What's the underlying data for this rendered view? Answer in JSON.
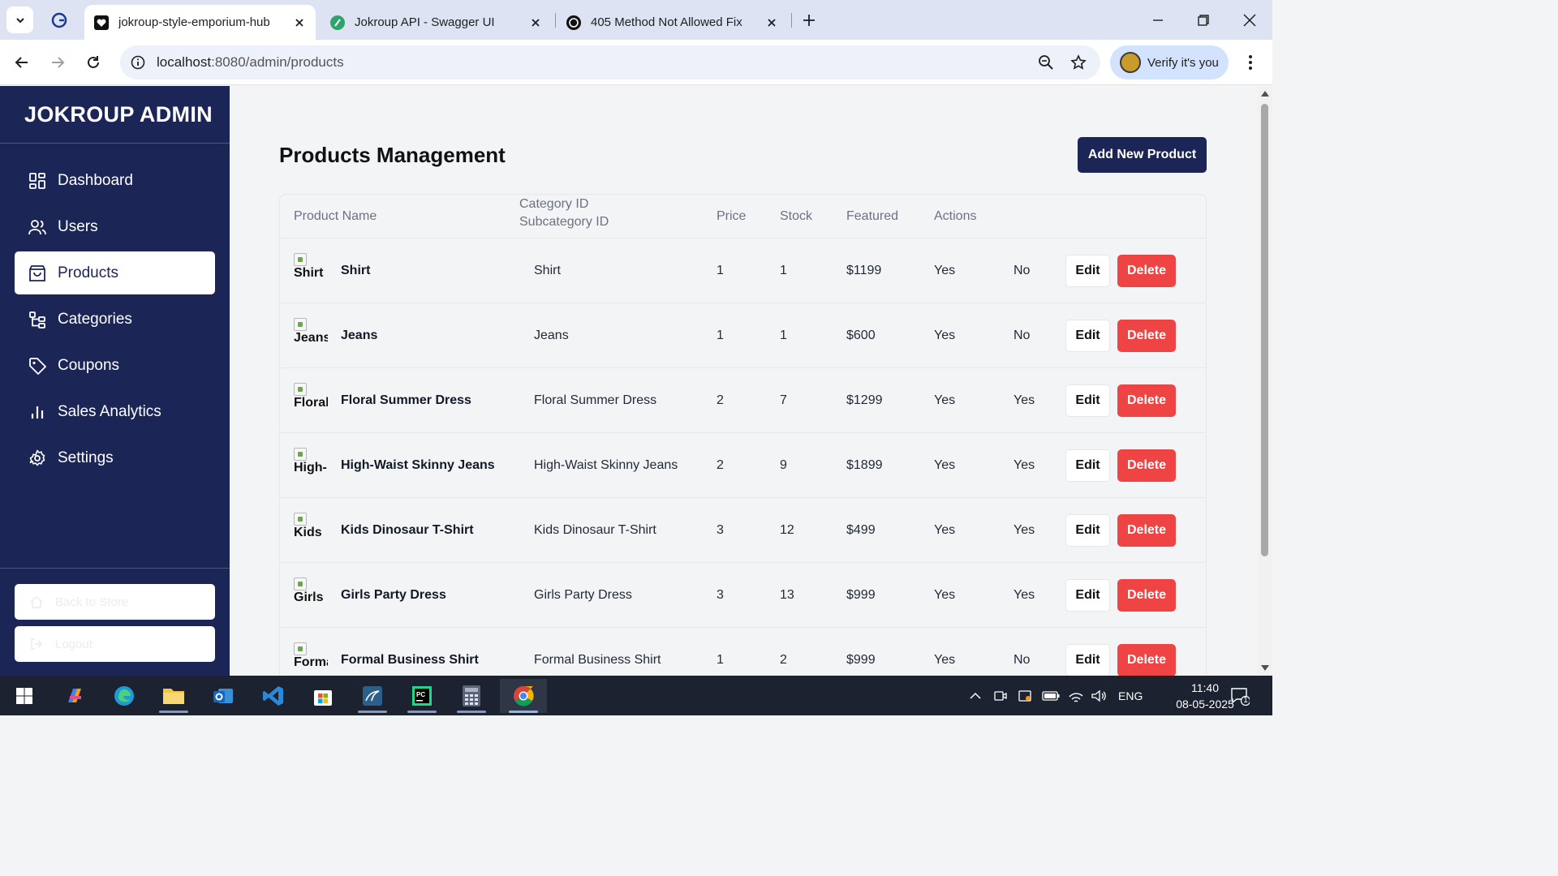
{
  "browser": {
    "tabs": [
      {
        "title": "jokroup-style-emporium-hub",
        "active": true,
        "favicon": "heart-icon"
      },
      {
        "title": "Jokroup API - Swagger UI",
        "active": false,
        "favicon": "swagger-icon"
      },
      {
        "title": "405 Method Not Allowed Fix",
        "active": false,
        "favicon": "openai-icon"
      }
    ],
    "url_host": "localhost",
    "url_path": ":8080/admin/products",
    "profile_label": "Verify it's you"
  },
  "sidebar": {
    "brand": "JOKROUP ADMIN",
    "items": [
      {
        "label": "Dashboard",
        "icon": "dashboard-icon",
        "active": false
      },
      {
        "label": "Users",
        "icon": "users-icon",
        "active": false
      },
      {
        "label": "Products",
        "icon": "bag-icon",
        "active": true
      },
      {
        "label": "Categories",
        "icon": "categories-icon",
        "active": false
      },
      {
        "label": "Coupons",
        "icon": "tag-icon",
        "active": false
      },
      {
        "label": "Sales Analytics",
        "icon": "chart-icon",
        "active": false
      },
      {
        "label": "Settings",
        "icon": "gear-icon",
        "active": false
      }
    ],
    "back_to_store": "Back to Store",
    "logout": "Logout"
  },
  "main": {
    "title": "Products Management",
    "add_button": "Add New Product",
    "headers": {
      "product_name": "Product Name",
      "category_id": "Category ID",
      "subcategory_id": "Subcategory ID",
      "price": "Price",
      "stock": "Stock",
      "featured": "Featured",
      "actions": "Actions"
    },
    "edit_label": "Edit",
    "delete_label": "Delete",
    "rows": [
      {
        "img_alt": "Shirt",
        "name": "Shirt",
        "desc": "Shirt",
        "category": "1",
        "subcategory": "1",
        "price": "$1199",
        "c1": "Yes",
        "c2": "No"
      },
      {
        "img_alt": "Jeans",
        "name": "Jeans",
        "desc": "Jeans",
        "category": "1",
        "subcategory": "1",
        "price": "$600",
        "c1": "Yes",
        "c2": "No"
      },
      {
        "img_alt": "Floral",
        "name": "Floral Summer Dress",
        "desc": "Floral Summer Dress",
        "category": "2",
        "subcategory": "7",
        "price": "$1299",
        "c1": "Yes",
        "c2": "Yes"
      },
      {
        "img_alt": "High-",
        "name": "High-Waist Skinny Jeans",
        "desc": "High-Waist Skinny Jeans",
        "category": "2",
        "subcategory": "9",
        "price": "$1899",
        "c1": "Yes",
        "c2": "Yes"
      },
      {
        "img_alt": "Kids",
        "name": "Kids Dinosaur T-Shirt",
        "desc": "Kids Dinosaur T-Shirt",
        "category": "3",
        "subcategory": "12",
        "price": "$499",
        "c1": "Yes",
        "c2": "Yes"
      },
      {
        "img_alt": "Girls",
        "name": "Girls Party Dress",
        "desc": "Girls Party Dress",
        "category": "3",
        "subcategory": "13",
        "price": "$999",
        "c1": "Yes",
        "c2": "Yes"
      },
      {
        "img_alt": "Forma",
        "name": "Formal Business Shirt",
        "desc": "Formal Business Shirt",
        "category": "1",
        "subcategory": "2",
        "price": "$999",
        "c1": "Yes",
        "c2": "No"
      }
    ]
  },
  "taskbar": {
    "language": "ENG",
    "time": "11:40",
    "date": "08-05-2025",
    "notification_count": "1"
  }
}
